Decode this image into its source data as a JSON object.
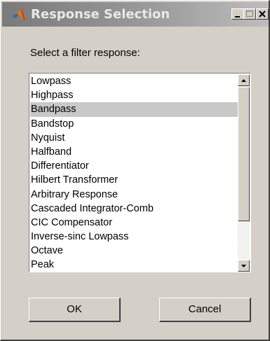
{
  "window": {
    "title": "Response Selection",
    "controls": [
      "minimize-icon",
      "maximize-icon",
      "close-icon"
    ],
    "app_icon": "matlab-icon"
  },
  "prompt": "Select a filter response:",
  "response_list": {
    "selected": "Bandpass",
    "items": [
      "Lowpass",
      "Highpass",
      "Bandpass",
      "Bandstop",
      "Nyquist",
      "Halfband",
      "Differentiator",
      "Hilbert Transformer",
      "Arbitrary Response",
      "Cascaded Integrator-Comb",
      "CIC Compensator",
      "Inverse-sinc Lowpass",
      "Octave",
      "Peak"
    ]
  },
  "buttons": {
    "ok": "OK",
    "cancel": "Cancel"
  },
  "colors": {
    "dialog_bg": "#d4d0c8",
    "title_text": "#e9e9e9",
    "selection_bg": "#c8c8c8"
  }
}
